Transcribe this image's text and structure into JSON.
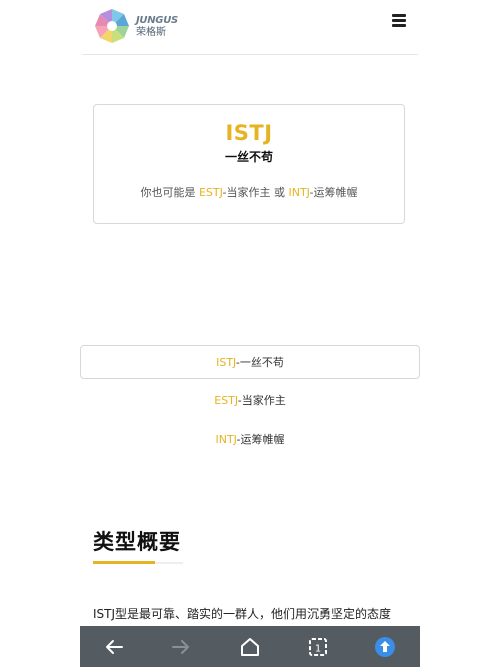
{
  "header": {
    "brand_en": "JUNGUS",
    "brand_cn": "荣格斯"
  },
  "type_card": {
    "code": "ISTJ",
    "name": "一丝不苟",
    "related_prefix": "你也可能是",
    "related_1_code": "ESTJ",
    "related_1_name": "-当家作主",
    "related_or": "或",
    "related_2_code": "INTJ",
    "related_2_name": "-运筹帷幄"
  },
  "tabs": [
    {
      "code": "ISTJ",
      "name": "-一丝不苟",
      "active": true
    },
    {
      "code": "ESTJ",
      "name": "-当家作主",
      "active": false
    },
    {
      "code": "INTJ",
      "name": "-运筹帷幄",
      "active": false
    }
  ],
  "section": {
    "title": "类型概要",
    "text": "ISTJ型是最可靠、踏实的一群人，他们用沉勇坚定的态度"
  },
  "colors": {
    "accent": "#e6b422",
    "bottom_bar": "#545b61",
    "share_button": "#3b8ee8"
  },
  "bottom_nav": {
    "tab_count": "1"
  },
  "icons": [
    "logo-icon",
    "menu-icon",
    "back-arrow-icon",
    "forward-arrow-icon",
    "home-icon",
    "tabs-icon",
    "share-icon"
  ]
}
